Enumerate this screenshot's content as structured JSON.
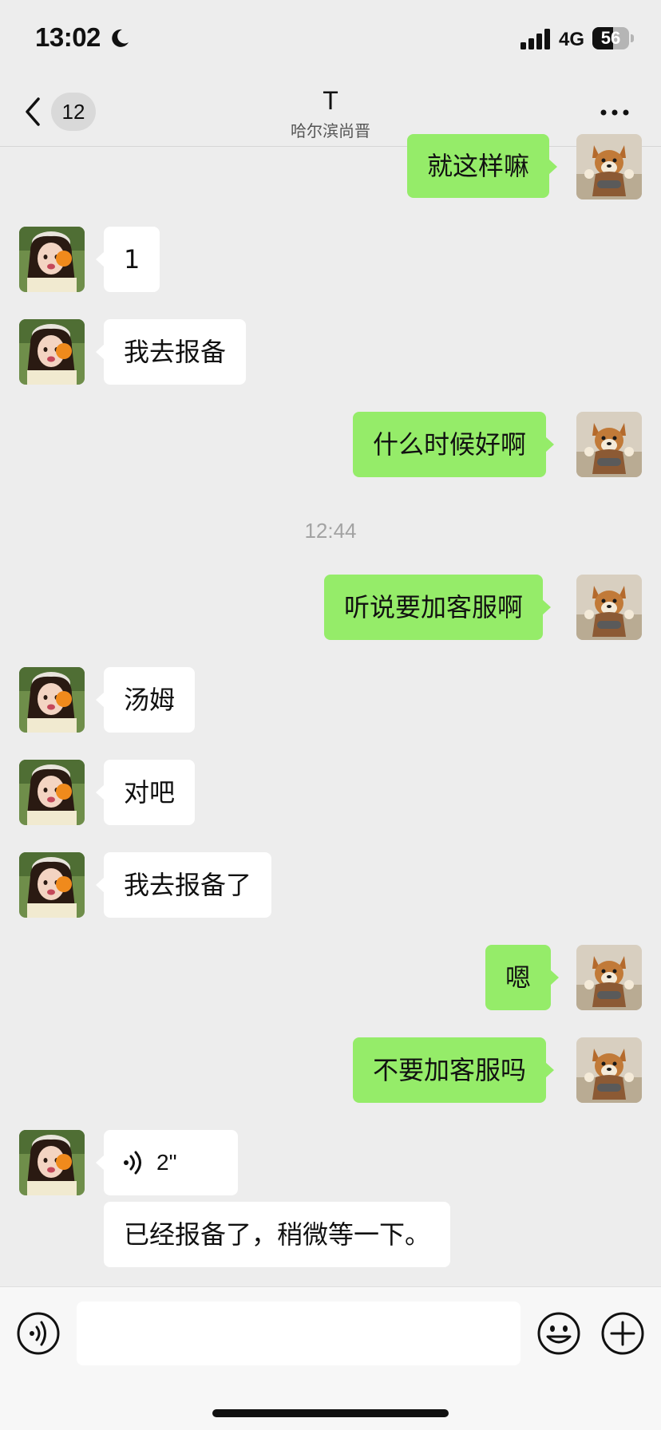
{
  "status_bar": {
    "time": "13:02",
    "network": "4G",
    "battery": "56",
    "battery_level": 0.56
  },
  "nav": {
    "unread_count": "12",
    "title": "T",
    "subtitle": "哈尔滨尚晋"
  },
  "timestamp": "12:44",
  "messages": [
    {
      "direction": "out",
      "text": "就这样嘛"
    },
    {
      "direction": "in",
      "text": "1"
    },
    {
      "direction": "in",
      "text": "我去报备"
    },
    {
      "direction": "out",
      "text": "什么时候好啊"
    },
    {
      "direction": "out",
      "text": "听说要加客服啊"
    },
    {
      "direction": "in",
      "text": "汤姆"
    },
    {
      "direction": "in",
      "text": "对吧"
    },
    {
      "direction": "in",
      "text": "我去报备了"
    },
    {
      "direction": "out",
      "text": "嗯"
    },
    {
      "direction": "out",
      "text": "不要加客服吗"
    },
    {
      "direction": "in",
      "type": "voice",
      "text": "2\""
    },
    {
      "direction": "in",
      "text": "已经报备了，稍微等一下。"
    }
  ],
  "input": {
    "placeholder": ""
  },
  "colors": {
    "background": "#ededed",
    "outgoing_bubble": "#95ec69",
    "incoming_bubble": "#ffffff"
  }
}
